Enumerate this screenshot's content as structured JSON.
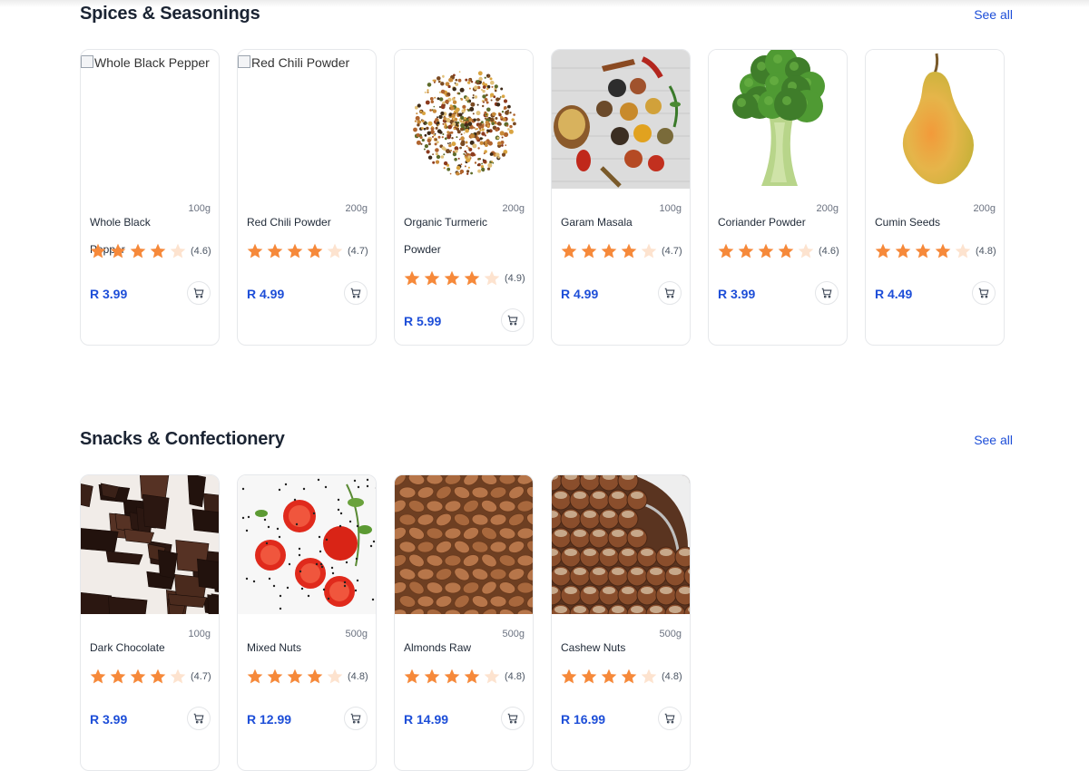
{
  "sections": [
    {
      "title": "Spices & Seasonings",
      "see_all": "See all",
      "products": [
        {
          "name": "Whole Black Pepper",
          "weight": "100g",
          "rating": "(4.6)",
          "stars": 4,
          "price": "R 3.99",
          "image": "broken",
          "alt": "Whole Black Pepper"
        },
        {
          "name": "Red Chili Powder",
          "weight": "200g",
          "rating": "(4.7)",
          "stars": 4,
          "price": "R 4.99",
          "image": "broken",
          "alt": "Red Chili Powder"
        },
        {
          "name": "Organic Turmeric Powder",
          "weight": "200g",
          "rating": "(4.9)",
          "stars": 4,
          "price": "R 5.99",
          "image": "spice-blend",
          "alt": ""
        },
        {
          "name": "Garam Masala",
          "weight": "100g",
          "rating": "(4.7)",
          "stars": 4,
          "price": "R 4.99",
          "image": "spice-board",
          "alt": ""
        },
        {
          "name": "Coriander Powder",
          "weight": "200g",
          "rating": "(4.6)",
          "stars": 4,
          "price": "R 3.99",
          "image": "broccoli",
          "alt": ""
        },
        {
          "name": "Cumin Seeds",
          "weight": "200g",
          "rating": "(4.8)",
          "stars": 4,
          "price": "R 4.49",
          "image": "pear",
          "alt": ""
        }
      ]
    },
    {
      "title": "Snacks & Confectionery",
      "see_all": "See all",
      "products": [
        {
          "name": "Dark Chocolate",
          "weight": "100g",
          "rating": "(4.7)",
          "stars": 4,
          "price": "R 3.99",
          "image": "chocolate",
          "alt": ""
        },
        {
          "name": "Mixed Nuts",
          "weight": "500g",
          "rating": "(4.8)",
          "stars": 4,
          "price": "R 12.99",
          "image": "tomatoes",
          "alt": ""
        },
        {
          "name": "Almonds Raw",
          "weight": "500g",
          "rating": "(4.8)",
          "stars": 4,
          "price": "R 14.99",
          "image": "almonds",
          "alt": ""
        },
        {
          "name": "Cashew Nuts",
          "weight": "500g",
          "rating": "(4.8)",
          "stars": 4,
          "price": "R 16.99",
          "image": "hazelnuts",
          "alt": ""
        }
      ]
    }
  ],
  "colors": {
    "accent": "#1d4ed8",
    "star_filled": "#f6893a",
    "star_empty": "#fde3cf"
  },
  "icons": {
    "star": "star-icon",
    "cart": "cart-icon"
  }
}
